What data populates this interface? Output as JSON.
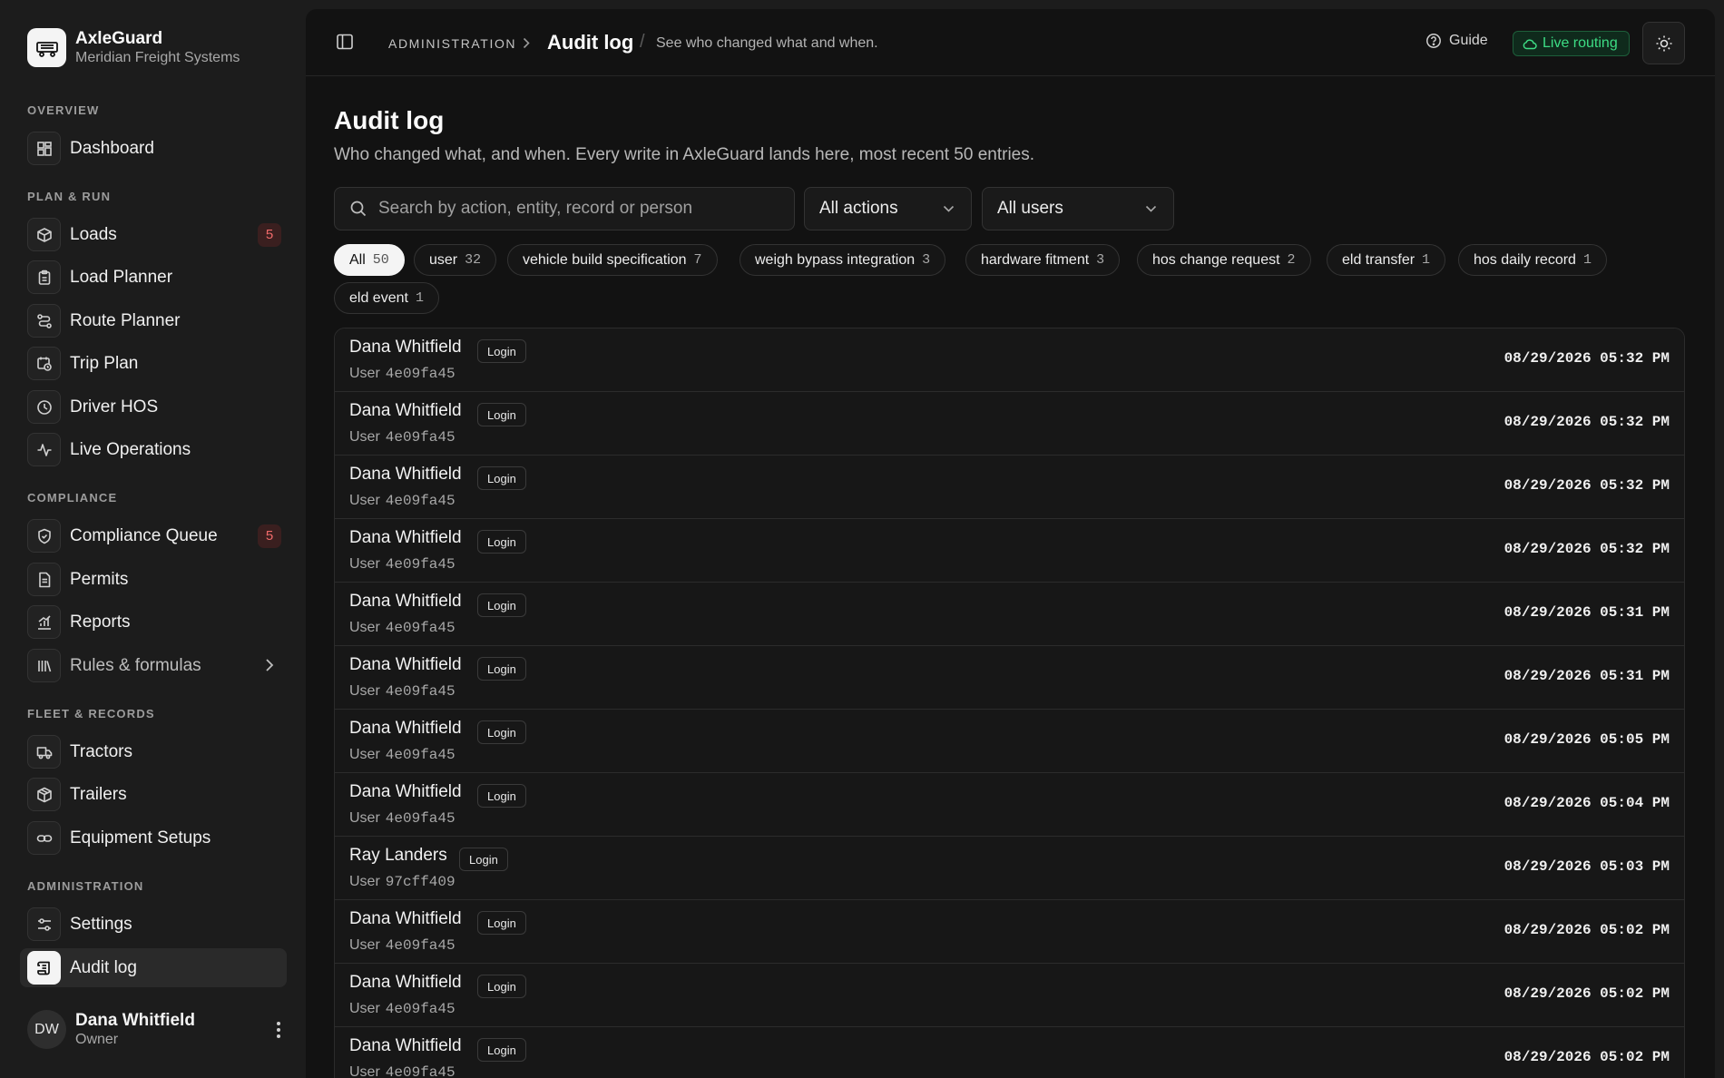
{
  "brand": {
    "name": "AxleGuard",
    "org": "Meridian Freight Systems"
  },
  "sidebar": {
    "sections": [
      {
        "label": "OVERVIEW"
      },
      {
        "label": "PLAN & RUN"
      },
      {
        "label": "COMPLIANCE"
      },
      {
        "label": "FLEET & RECORDS"
      },
      {
        "label": "ADMINISTRATION"
      }
    ],
    "items": [
      {
        "label": "Dashboard",
        "icon": "dashboard-icon"
      },
      {
        "label": "Loads",
        "icon": "box-icon",
        "badge": "5"
      },
      {
        "label": "Load Planner",
        "icon": "clipboard-icon"
      },
      {
        "label": "Route Planner",
        "icon": "route-icon"
      },
      {
        "label": "Trip Plan",
        "icon": "calendar-clock-icon"
      },
      {
        "label": "Driver HOS",
        "icon": "clock-icon"
      },
      {
        "label": "Live Operations",
        "icon": "activity-icon"
      },
      {
        "label": "Compliance Queue",
        "icon": "shield-icon",
        "badge": "5"
      },
      {
        "label": "Permits",
        "icon": "document-icon"
      },
      {
        "label": "Reports",
        "icon": "chart-icon"
      },
      {
        "label": "Rules & formulas",
        "icon": "library-icon"
      },
      {
        "label": "Tractors",
        "icon": "truck-icon"
      },
      {
        "label": "Trailers",
        "icon": "package-icon"
      },
      {
        "label": "Equipment Setups",
        "icon": "link-icon"
      },
      {
        "label": "Settings",
        "icon": "sliders-icon"
      },
      {
        "label": "Audit log",
        "icon": "scroll-icon"
      }
    ]
  },
  "user": {
    "initials": "DW",
    "name": "Dana Whitfield",
    "role": "Owner"
  },
  "topbar": {
    "section": "ADMINISTRATION",
    "title": "Audit log",
    "description": "See who changed what and when.",
    "guide": "Guide",
    "live": "Live routing"
  },
  "page": {
    "title": "Audit log",
    "subtitle": "Who changed what, and when. Every write in AxleGuard lands here, most recent 50 entries."
  },
  "filters": {
    "search_placeholder": "Search by action, entity, record or person",
    "actions": "All actions",
    "users": "All users"
  },
  "chips": [
    {
      "label": "All",
      "count": "50"
    },
    {
      "label": "user",
      "count": "32"
    },
    {
      "label": "vehicle build specification",
      "count": "7"
    },
    {
      "label": "weigh bypass integration",
      "count": "3"
    },
    {
      "label": "hardware fitment",
      "count": "3"
    },
    {
      "label": "hos change request",
      "count": "2"
    },
    {
      "label": "eld transfer",
      "count": "1"
    },
    {
      "label": "hos daily record",
      "count": "1"
    },
    {
      "label": "eld event",
      "count": "1"
    }
  ],
  "rows": [
    {
      "name": "Dana Whitfield",
      "action": "Login",
      "entity": "User",
      "id": "4e09fa45",
      "time": "08/29/2026 05:32 PM"
    },
    {
      "name": "Dana Whitfield",
      "action": "Login",
      "entity": "User",
      "id": "4e09fa45",
      "time": "08/29/2026 05:32 PM"
    },
    {
      "name": "Dana Whitfield",
      "action": "Login",
      "entity": "User",
      "id": "4e09fa45",
      "time": "08/29/2026 05:32 PM"
    },
    {
      "name": "Dana Whitfield",
      "action": "Login",
      "entity": "User",
      "id": "4e09fa45",
      "time": "08/29/2026 05:32 PM"
    },
    {
      "name": "Dana Whitfield",
      "action": "Login",
      "entity": "User",
      "id": "4e09fa45",
      "time": "08/29/2026 05:31 PM"
    },
    {
      "name": "Dana Whitfield",
      "action": "Login",
      "entity": "User",
      "id": "4e09fa45",
      "time": "08/29/2026 05:31 PM"
    },
    {
      "name": "Dana Whitfield",
      "action": "Login",
      "entity": "User",
      "id": "4e09fa45",
      "time": "08/29/2026 05:05 PM"
    },
    {
      "name": "Dana Whitfield",
      "action": "Login",
      "entity": "User",
      "id": "4e09fa45",
      "time": "08/29/2026 05:04 PM"
    },
    {
      "name": "Ray Landers",
      "action": "Login",
      "entity": "User",
      "id": "97cff409",
      "time": "08/29/2026 05:03 PM"
    },
    {
      "name": "Dana Whitfield",
      "action": "Login",
      "entity": "User",
      "id": "4e09fa45",
      "time": "08/29/2026 05:02 PM"
    },
    {
      "name": "Dana Whitfield",
      "action": "Login",
      "entity": "User",
      "id": "4e09fa45",
      "time": "08/29/2026 05:02 PM"
    },
    {
      "name": "Dana Whitfield",
      "action": "Login",
      "entity": "User",
      "id": "4e09fa45",
      "time": "08/29/2026 05:02 PM"
    }
  ],
  "colors": {
    "accent_green": "#3ddc84",
    "badge_red": "#f06a6a",
    "background": "#121212"
  }
}
